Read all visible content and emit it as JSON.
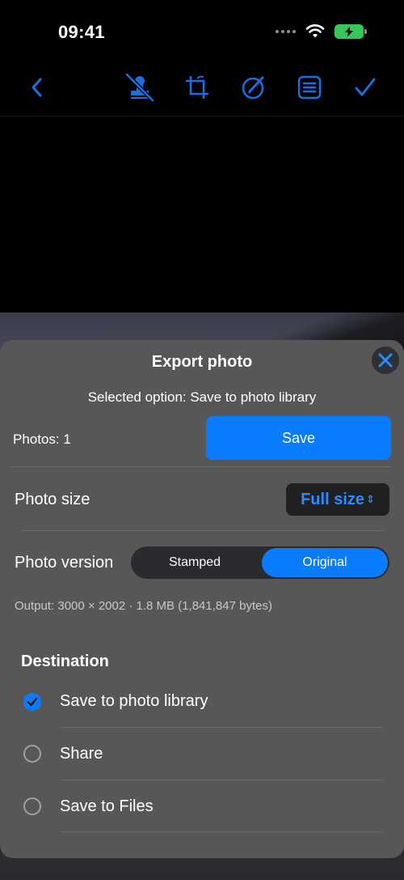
{
  "status": {
    "time": "09:41"
  },
  "toolbar": {
    "icons": [
      "chevron-left-icon",
      "stamp-off-icon",
      "crop-icon",
      "edit-circle-icon",
      "list-icon",
      "checkmark-icon"
    ]
  },
  "sheet": {
    "title": "Export photo",
    "selected_option": "Selected option: Save to photo library",
    "photos_count": "Photos: 1",
    "save_label": "Save",
    "photo_size_label": "Photo size",
    "photo_size_value": "Full size",
    "photo_version_label": "Photo version",
    "version_options": [
      "Stamped",
      "Original"
    ],
    "version_selected": "Original",
    "output": "Output: 3000 × 2002 · 1.8 MB (1,841,847 bytes)",
    "destination_title": "Destination",
    "destinations": [
      {
        "label": "Save to photo library",
        "checked": true
      },
      {
        "label": "Share",
        "checked": false
      },
      {
        "label": "Save to Files",
        "checked": false
      }
    ]
  },
  "colors": {
    "accent": "#0a7cff",
    "sheet": "#575757",
    "battery": "#34c759"
  }
}
